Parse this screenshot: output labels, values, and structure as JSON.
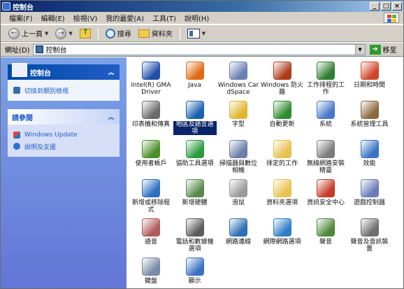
{
  "window": {
    "title": "控制台",
    "buttons": [
      "_",
      "□",
      "×"
    ]
  },
  "menu": {
    "items": [
      "檔案(F)",
      "編輯(E)",
      "檢視(V)",
      "我的最愛(A)",
      "工具(T)",
      "說明(H)"
    ]
  },
  "toolbar": {
    "back_label": "上一頁",
    "search_label": "搜尋",
    "folders_label": "資料夾"
  },
  "address": {
    "label": "網址(D)",
    "value": "控制台",
    "go_label": "移至"
  },
  "left_panel": {
    "control_panel": {
      "title": "控制台",
      "items": [
        {
          "label": "切換到類別檢視",
          "icon": "switch-view-icon"
        }
      ]
    },
    "see_also": {
      "title": "請參閱",
      "items": [
        {
          "label": "Windows Update",
          "icon": "windows-update-icon"
        },
        {
          "label": "說明及支援",
          "icon": "help-icon"
        }
      ]
    }
  },
  "icons": [
    {
      "label": "Intel(R) GMA Driver",
      "icon": "intel-gma-icon",
      "color": "#1f4fa8"
    },
    {
      "label": "Java",
      "icon": "java-icon",
      "color": "#e06a14"
    },
    {
      "label": "Windows CardSpace",
      "icon": "cardspace-icon",
      "color": "#6a7fb4"
    },
    {
      "label": "Windows 防火牆",
      "icon": "firewall-icon",
      "color": "#b03b1c"
    },
    {
      "label": "工作排程的工作",
      "icon": "scheduled-tasks-icon",
      "color": "#2e7d32"
    },
    {
      "label": "日期和時間",
      "icon": "date-time-icon",
      "color": "#d0462b"
    },
    {
      "label": "印表機和傳真",
      "icon": "printers-icon",
      "color": "#6b6b6b"
    },
    {
      "label": "地區及語言選項",
      "icon": "regional-icon",
      "color": "#1c5fb0"
    },
    {
      "label": "字型",
      "icon": "fonts-icon",
      "color": "#e0b52e"
    },
    {
      "label": "自動更新",
      "icon": "auto-update-icon",
      "color": "#2f8d2f"
    },
    {
      "label": "系統",
      "icon": "system-icon",
      "color": "#4a78c8"
    },
    {
      "label": "系統管理工具",
      "icon": "admin-tools-icon",
      "color": "#8a6a3c"
    },
    {
      "label": "使用者帳戶",
      "icon": "user-accounts-icon",
      "color": "#4c8f2a"
    },
    {
      "label": "協助工具選項",
      "icon": "accessibility-icon",
      "color": "#2a9a3e"
    },
    {
      "label": "掃描器與數位相機",
      "icon": "scanners-icon",
      "color": "#6b7ea8"
    },
    {
      "label": "排定的工作",
      "icon": "tasks-folder-icon",
      "color": "#e6c14b"
    },
    {
      "label": "無線網路安裝精靈",
      "icon": "wireless-icon",
      "color": "#7c7c7c"
    },
    {
      "label": "效能",
      "icon": "performance-icon",
      "color": "#3b72c4"
    },
    {
      "label": "新增或移除程式",
      "icon": "add-remove-icon",
      "color": "#2c6fc0"
    },
    {
      "label": "新增硬體",
      "icon": "add-hardware-icon",
      "color": "#5a8a4a"
    },
    {
      "label": "滑鼠",
      "icon": "mouse-icon",
      "color": "#9a9a9a"
    },
    {
      "label": "資料夾選項",
      "icon": "folder-options-icon",
      "color": "#e8c24e"
    },
    {
      "label": "資訊安全中心",
      "icon": "security-center-icon",
      "color": "#c43b2a"
    },
    {
      "label": "遊戲控制器",
      "icon": "game-controller-icon",
      "color": "#6c7cb8"
    },
    {
      "label": "語音",
      "icon": "speech-icon",
      "color": "#b05a5a"
    },
    {
      "label": "電話和數據機選項",
      "icon": "phone-modem-icon",
      "color": "#5c5c5c"
    },
    {
      "label": "網路連線",
      "icon": "network-icon",
      "color": "#2b6fb6"
    },
    {
      "label": "網際網路選項",
      "icon": "internet-options-icon",
      "color": "#2f7fc8"
    },
    {
      "label": "聲音",
      "icon": "sound-icon",
      "color": "#4f8a3a"
    },
    {
      "label": "聲音及音訊裝置",
      "icon": "audio-devices-icon",
      "color": "#6e6e6e"
    },
    {
      "label": "鍵盤",
      "icon": "keyboard-icon",
      "color": "#7a8aa8"
    },
    {
      "label": "顯示",
      "icon": "display-icon",
      "color": "#3a72c2"
    }
  ],
  "selected_icon": 7
}
